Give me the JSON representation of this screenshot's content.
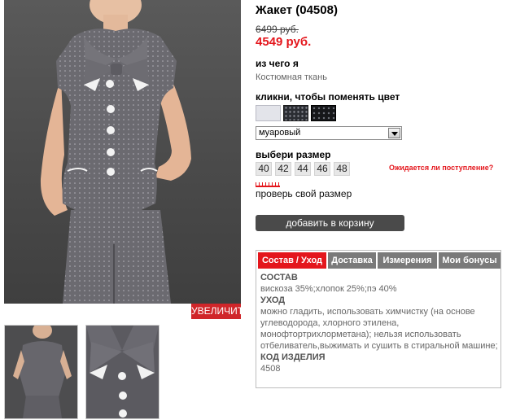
{
  "product": {
    "title": "Жакет (04508)",
    "old_price": "6499 руб.",
    "new_price": "4549 руб."
  },
  "gallery": {
    "zoom_label": "УВЕЛИЧИТЬ"
  },
  "material": {
    "heading": "из чего я",
    "value": "Костюмная ткань"
  },
  "color": {
    "heading": "кликни, чтобы поменять цвет",
    "selected": "муаровый",
    "swatch_colors": [
      "#e3e4ea",
      "#2b2d33",
      "#16171a"
    ]
  },
  "size": {
    "heading": "выбери размер",
    "options": [
      "40",
      "42",
      "44",
      "46",
      "48"
    ],
    "expect_link": "Ожидается ли поступление?",
    "check_link": "проверь свой размер"
  },
  "cart": {
    "button_label": "добавить в корзину"
  },
  "tabs": {
    "items": [
      {
        "label": "Состав / Уход",
        "active": true
      },
      {
        "label": "Доставка",
        "active": false
      },
      {
        "label": "Измерения",
        "active": false
      },
      {
        "label": "Мои бонусы",
        "active": false
      }
    ],
    "content": {
      "composition_heading": "СОСТАВ",
      "composition": "вискоза 35%;хлопок 25%;пэ 40%",
      "care_heading": "УХОД",
      "care": "можно гладить, использовать химчистку (на основе углеводорода, хлорного этилена, монофтортрихлорметана); нельзя использовать отбеливатель,выжимать и сушить в стиральной машине;",
      "code_heading": "КОД ИЗДЕЛИЯ",
      "code": "4508"
    }
  },
  "colors": {
    "accent_red": "#e4161c",
    "button_dark": "#4a4a4a",
    "tab_gray": "#7a7a7a"
  }
}
